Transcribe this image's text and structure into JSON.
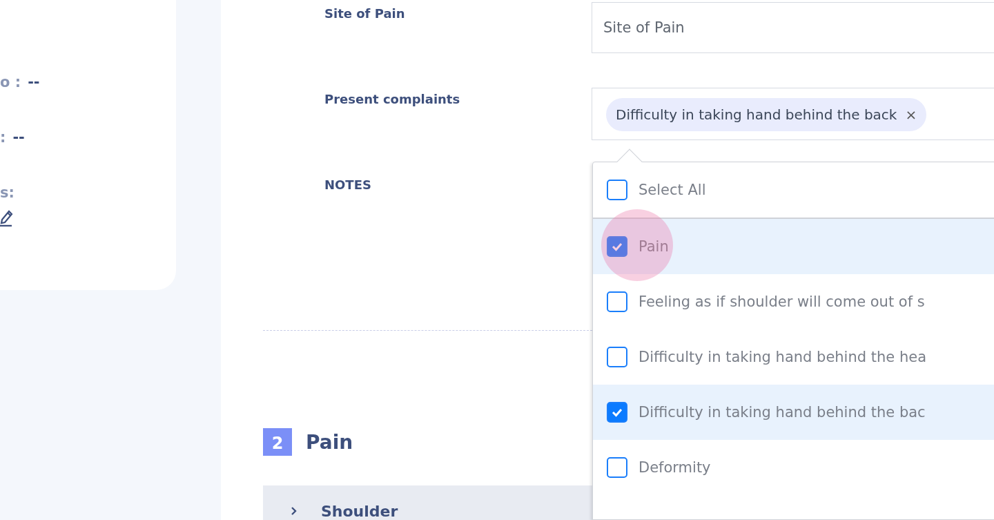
{
  "sidebar": {
    "lines": [
      {
        "label": "o :",
        "value": "--"
      },
      {
        "label": ":",
        "value": "--"
      },
      {
        "label": "s:"
      }
    ]
  },
  "form": {
    "fields": [
      {
        "kind": "text",
        "label": "Site of Pain",
        "placeholder": "Site of Pain"
      },
      {
        "kind": "multiselect",
        "label": "Present complaints",
        "chips": [
          {
            "text": "Difficulty in taking hand behind the back",
            "remove": "×"
          }
        ]
      },
      {
        "kind": "notes",
        "label": "NOTES"
      }
    ]
  },
  "dropdown": {
    "select_all": {
      "label": "Select All",
      "checked": false
    },
    "options": [
      {
        "label": "Pain",
        "checked": true,
        "focused": true
      },
      {
        "label": "Feeling as if shoulder will come out of s",
        "checked": false,
        "focused": false
      },
      {
        "label": "Difficulty in taking hand behind the hea",
        "checked": false,
        "focused": false
      },
      {
        "label": "Difficulty in taking hand behind the bac",
        "checked": true,
        "focused": false
      },
      {
        "label": "Deformity",
        "checked": false,
        "focused": false
      }
    ]
  },
  "section": {
    "number": "2",
    "title": "Pain",
    "accordion": [
      {
        "label": "Shoulder",
        "expanded": false
      }
    ]
  }
}
